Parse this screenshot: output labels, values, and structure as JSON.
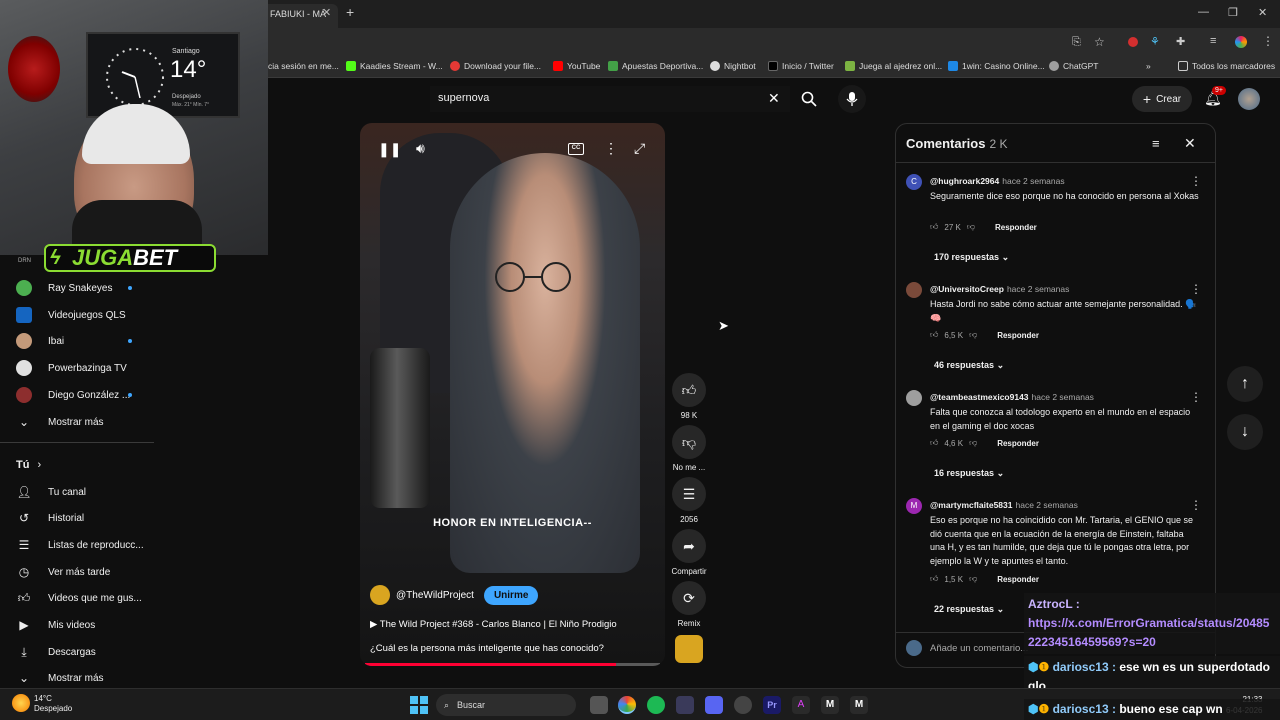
{
  "browser": {
    "tab_title": "FABIUKI - MÁ",
    "bookmarks": [
      "cia sesión en me...",
      "Kaadies Stream - W...",
      "Download your file...",
      "YouTube",
      "Apuestas Deportiva...",
      "Nightbot",
      "Inicio / Twitter",
      "Juega al ajedrez onl...",
      "1win: Casino Online...",
      "ChatGPT",
      "Todos los marcadores"
    ]
  },
  "webcam": {
    "city": "Santiago",
    "temp": "14°",
    "weather": "Despejado",
    "weather_sub": "Máx. 21° Mín. 7°",
    "brand": "JUGA",
    "brand2": "BET"
  },
  "youtube": {
    "search_value": "supernova",
    "create_label": "Crear",
    "notif_badge": "9+"
  },
  "sidebar": {
    "subs": [
      {
        "label": "Ray Snakeyes",
        "new": true
      },
      {
        "label": "Videojuegos QLS",
        "new": false
      },
      {
        "label": "Ibai",
        "new": true
      },
      {
        "label": "Powerbazinga TV",
        "new": false
      },
      {
        "label": "Diego González ...",
        "new": true
      }
    ],
    "show_more": "Mostrar más",
    "you_header": "Tú",
    "you_items": [
      "Tu canal",
      "Historial",
      "Listas de reproducc...",
      "Ver más tarde",
      "Videos que me gus...",
      "Mis videos",
      "Descargas",
      "Mostrar más"
    ]
  },
  "video": {
    "caption": "HONOR EN INTELIGENCIA--",
    "channel": "@TheWildProject",
    "join_label": "Unirme",
    "title": "The Wild Project #368 - Carlos Blanco | El Niño Prodigio",
    "description": "¿Cuál es la persona más inteligente que has conocido?",
    "progress": 0.85,
    "likes": "98 K",
    "dislike_label": "No me ...",
    "comments_count": "2056",
    "share_label": "Compartir",
    "remix_label": "Remix"
  },
  "comments": {
    "title": "Comentarios",
    "count": "2 K",
    "items": [
      {
        "initial": "C",
        "color": "#3f51b5",
        "author": "@hughroark2964",
        "time": "hace 2 semanas",
        "text": "Seguramente dice eso porque no ha conocido en persona al Xokas",
        "likes": "27 K",
        "reply": "Responder",
        "replies": "170 respuestas"
      },
      {
        "initial": "",
        "color": "#7a4a3a",
        "author": "@UniversitoCreep",
        "time": "hace 2 semanas",
        "text": "Hasta Jordi no sabe cómo actuar ante semejante personalidad. 🗣️🧠",
        "likes": "6,5 K",
        "reply": "Responder",
        "replies": "46 respuestas"
      },
      {
        "initial": "",
        "color": "#9e9e9e",
        "author": "@teambeastmexico9143",
        "time": "hace 2 semanas",
        "text": "Falta que conozca al todologo experto en el mundo en el espacio en el gaming el doc xocas",
        "likes": "4,6 K",
        "reply": "Responder",
        "replies": "16 respuestas"
      },
      {
        "initial": "M",
        "color": "#9c27b0",
        "author": "@martymcflaite5831",
        "time": "hace 2 semanas",
        "text": "Eso es porque no ha coincidido con Mr. Tartaria, el GENIO que se dió cuenta que en la ecuación de la energía de Einstein, faltaba una H, y es tan humilde, que deja que tú le pongas otra letra, por ejemplo la W y te apuntes el tanto.",
        "likes": "1,5 K",
        "reply": "Responder",
        "replies": "22 respuestas"
      }
    ],
    "add_placeholder": "Añade un comentario..."
  },
  "chat": [
    {
      "user": "AztrocL :",
      "msg": "https://x.com/ErrorGramatica/status/2048522234516459569?s=20"
    },
    {
      "user": "dariosc13 :",
      "msg": "ese wn es un superdotado qlo"
    },
    {
      "user": "dariosc13 :",
      "msg": "bueno ese cap wn"
    }
  ],
  "taskbar": {
    "temp": "14°C",
    "weather": "Despejado",
    "search_label": "Buscar",
    "time": "21:33",
    "date": "6-04-2026"
  }
}
